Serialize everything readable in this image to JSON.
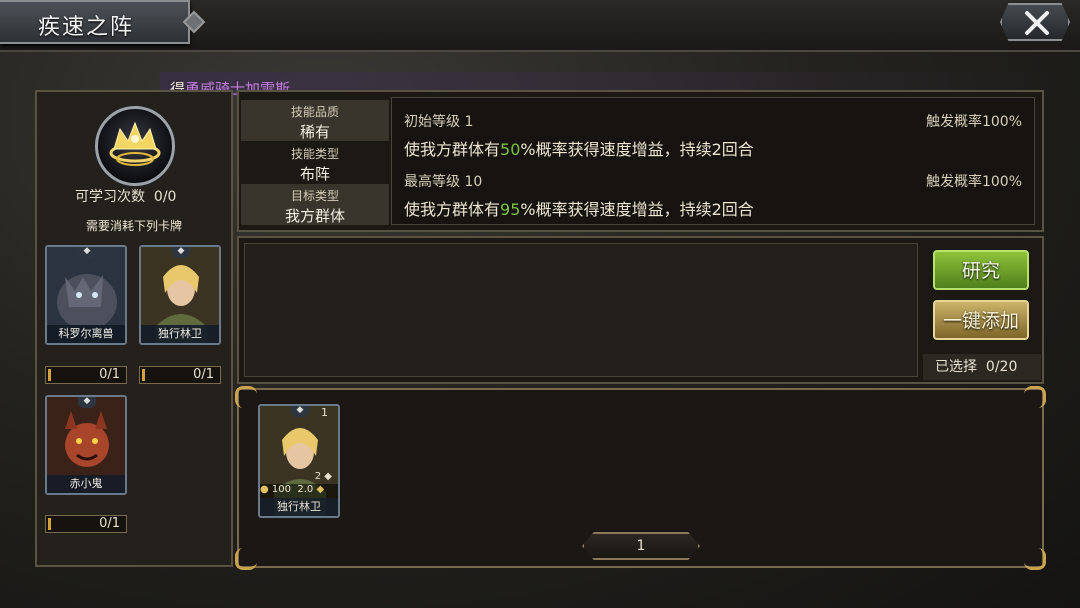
{
  "header": {
    "title": "疾速之阵"
  },
  "skill": {
    "source_prefix": "得",
    "source_name": "勇威骑士加雷斯"
  },
  "left": {
    "learn_label": "可学习次数",
    "learn_value": "0/0",
    "need_text": "需要消耗下列卡牌",
    "cards": [
      {
        "name": "科罗尔离兽",
        "count": "0/1"
      },
      {
        "name": "独行林卫",
        "count": "0/1"
      },
      {
        "name": "赤小鬼",
        "count": "0/1"
      }
    ]
  },
  "attrs": [
    {
      "key": "技能品质",
      "value": "稀有"
    },
    {
      "key": "技能类型",
      "value": "布阵"
    },
    {
      "key": "目标类型",
      "value": "我方群体"
    }
  ],
  "levels": {
    "initial_label": "初始等级 1",
    "initial_prob": "触发概率100%",
    "initial_desc_a": "使我方群体有",
    "initial_pct": "50",
    "initial_desc_b": "%概率获得速度增益，持续2回合",
    "max_label": "最高等级 10",
    "max_prob": "触发概率100%",
    "max_desc_a": "使我方群体有",
    "max_pct": "95",
    "max_desc_b": "%概率获得速度增益，持续2回合"
  },
  "actions": {
    "research": "研究",
    "quick_add": "一键添加",
    "selected_label": "已选择",
    "selected_value": "0/20"
  },
  "pick": {
    "name": "独行林卫",
    "count": "1",
    "cost": "100",
    "speed": "2.0",
    "level": "2"
  },
  "pager": {
    "page": "1"
  },
  "colors": {
    "accent_green": "#7cc343",
    "purple": "#c77be6",
    "gold": "#c9a34e"
  }
}
